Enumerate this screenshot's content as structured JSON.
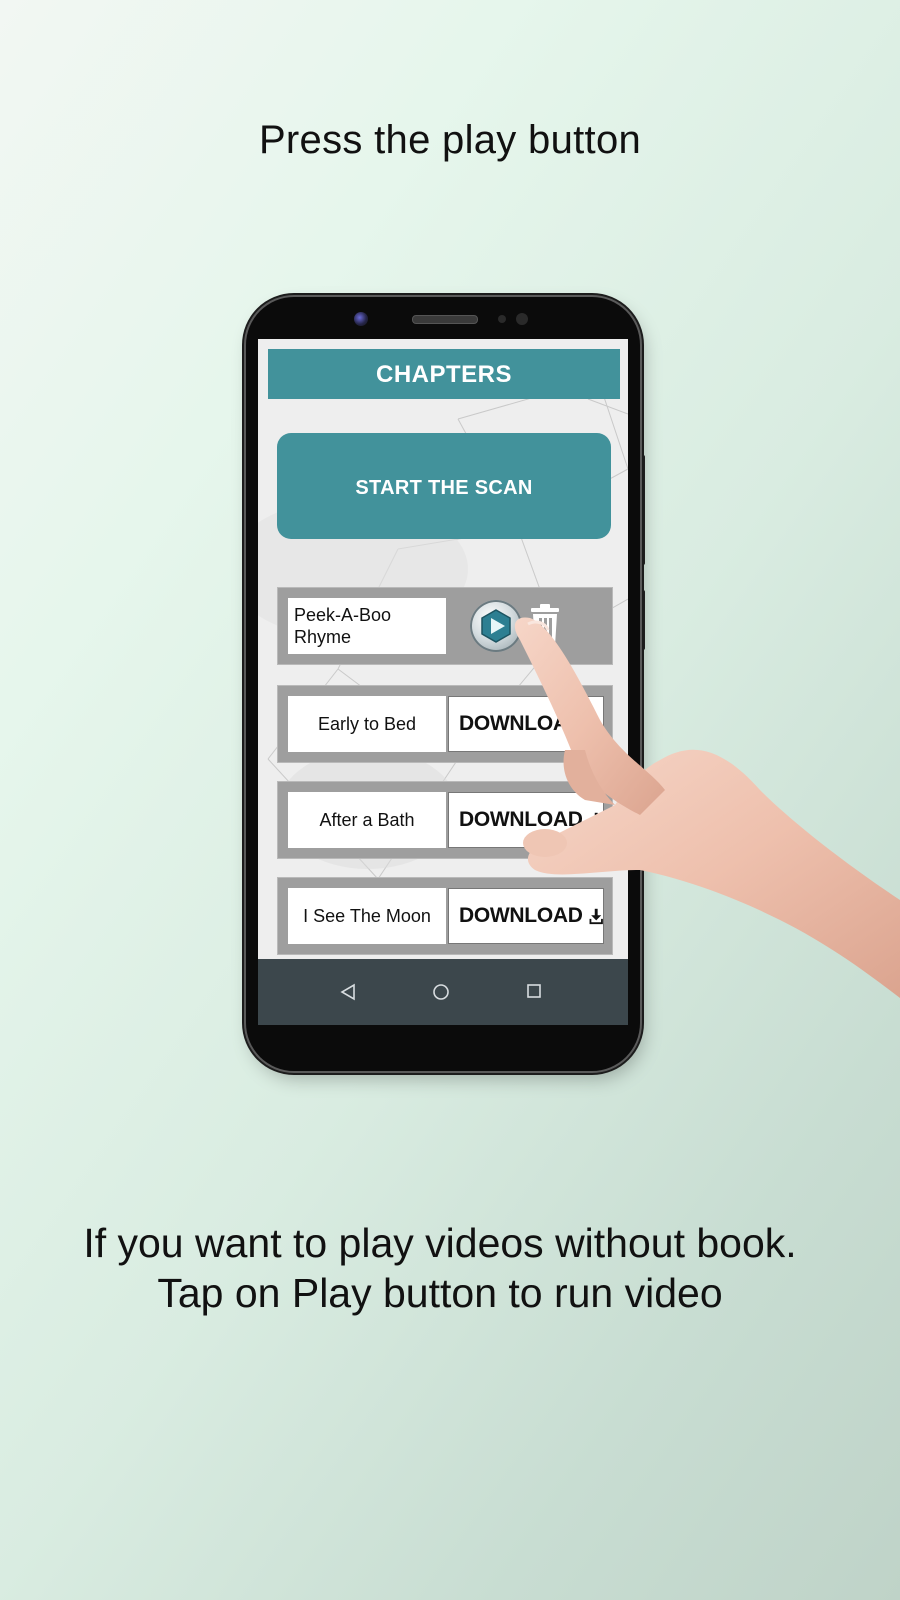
{
  "headline": "Press the play button",
  "caption": "If you want to play videos without book. Tap on Play button to run video",
  "app": {
    "title": "CHAPTERS",
    "scan_button": "START THE SCAN",
    "chapters": [
      {
        "name": "Peek-A-Boo Rhyme",
        "state": "downloaded"
      },
      {
        "name": "Early to Bed",
        "action": "DOWNLOAD"
      },
      {
        "name": "After a Bath",
        "action": "DOWNLOAD"
      },
      {
        "name": "I See The Moon",
        "action": "DOWNLOAD"
      }
    ],
    "accent_color": "#42929b"
  },
  "icons": {
    "play": "play-icon",
    "delete": "trash-icon",
    "download": "download-icon",
    "nav_back": "back-triangle-icon",
    "nav_home": "home-circle-icon",
    "nav_recent": "recent-square-icon"
  }
}
